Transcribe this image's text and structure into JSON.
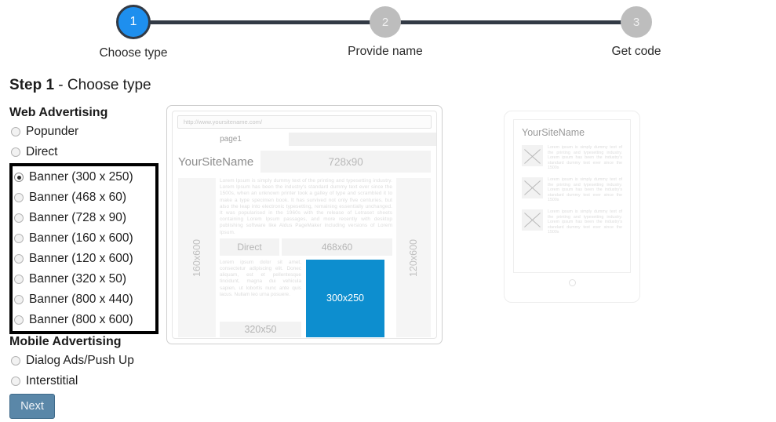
{
  "stepper": {
    "steps": [
      {
        "number": "1",
        "label": "Choose type",
        "state": "active"
      },
      {
        "number": "2",
        "label": "Provide name",
        "state": "inactive"
      },
      {
        "number": "3",
        "label": "Get code",
        "state": "inactive"
      }
    ],
    "active_color": "#1e8fee",
    "inactive_color": "#bdbdbd",
    "track_color": "#323a45"
  },
  "page": {
    "title_bold": "Step 1",
    "title_rest": " - Choose type"
  },
  "options": {
    "web_heading": "Web Advertising",
    "mobile_heading": "Mobile Advertising",
    "web_items_before": [
      {
        "label": "Popunder",
        "checked": false
      },
      {
        "label": "Direct",
        "checked": false
      }
    ],
    "banner_items": [
      {
        "label": "Banner (300 x 250)",
        "checked": true
      },
      {
        "label": "Banner (468 x 60)",
        "checked": false
      },
      {
        "label": "Banner (728 x 90)",
        "checked": false
      },
      {
        "label": "Banner (160 x 600)",
        "checked": false
      },
      {
        "label": "Banner (120 x 600)",
        "checked": false
      },
      {
        "label": "Banner (320 x 50)",
        "checked": false
      },
      {
        "label": "Banner (800 x 440)",
        "checked": false
      },
      {
        "label": "Banner (800 x 600)",
        "checked": false
      }
    ],
    "mobile_items": [
      {
        "label": "Dialog Ads/Push Up",
        "checked": false
      },
      {
        "label": "Interstitial",
        "checked": false
      }
    ],
    "highlight_border_color": "#000000"
  },
  "actions": {
    "next_label": "Next",
    "next_color": "#5a87a8"
  },
  "browser_preview": {
    "url": "http://www.yoursitename.com/",
    "tab_label": "page1",
    "site_name": "YourSiteName",
    "banner_728": "728x90",
    "left_skyscraper": "160x600",
    "right_skyscraper": "120x600",
    "lorem_top": "Lorem Ipsum is simply dummy text of the printing and typesetting industry. Lorem Ipsum has been the industry's standard dummy text ever since the 1500s, when an unknown printer took a galley of type and scrambled it to make a type specimen book. It has survived not only five centuries, but also the leap into electronic typesetting, remaining essentially unchanged. It was popularised in the 1960s with the release of Letraset sheets containing Lorem Ipsum passages, and more recently with desktop publishing software like Aldus PageMaker including versions of Lorem Ipsum.",
    "direct_label": "Direct",
    "banner_468": "468x60",
    "lorem_bottom": "Lorem ipsum dolor sit amet, consectetur adipiscing elit. Donec aliquam, est et pellentesque tincidunt, magna dui vehicula sapien, ut lobortis nunc ante quis lacus. Nullam leo urna posuere.",
    "banner_320": "320x50",
    "banner_300": "300x250",
    "banner_300_color": "#0d8ecf"
  },
  "tablet_preview": {
    "site_name": "YourSiteName",
    "rows": [
      {
        "text": "Lorem ipsum is simply dummy text of the printing and typesetting industry. Lorem ipsum has been the industry's standard dummy text ever since the 1500s"
      },
      {
        "text": "Lorem ipsum is simply dummy text of the printing and typesetting industry. Lorem ipsum has been the industry's standard dummy text ever since the 1500s"
      },
      {
        "text": "Lorem ipsum is simply dummy text of the printing and typesetting industry. Lorem ipsum has been the industry's standard dummy text ever since the 1500s"
      }
    ]
  }
}
